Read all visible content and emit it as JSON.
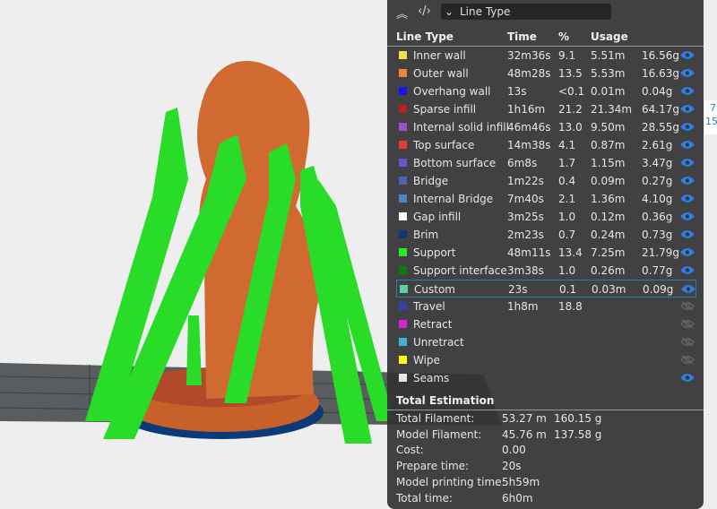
{
  "toolbar": {
    "collapse_icon": "double-chevron-up-icon",
    "code_icon": "code-brackets-icon",
    "view_select_value": "Line Type"
  },
  "table": {
    "headers": [
      "Line Type",
      "Time",
      "%",
      "Usage"
    ],
    "rows": [
      {
        "name": "Inner wall",
        "time": "32m36s",
        "pct": "9.1",
        "len": "5.51m",
        "weight": "16.56g",
        "color": "#f2e04a",
        "visible": true
      },
      {
        "name": "Outer wall",
        "time": "48m28s",
        "pct": "13.5",
        "len": "5.53m",
        "weight": "16.63g",
        "color": "#f08536",
        "visible": true
      },
      {
        "name": "Overhang wall",
        "time": "13s",
        "pct": "<0.1",
        "len": "0.01m",
        "weight": "0.04g",
        "color": "#1414f0",
        "visible": true
      },
      {
        "name": "Sparse infill",
        "time": "1h16m",
        "pct": "21.2",
        "len": "21.34m",
        "weight": "64.17g",
        "color": "#b22424",
        "visible": true
      },
      {
        "name": "Internal solid infill",
        "time": "46m46s",
        "pct": "13.0",
        "len": "9.50m",
        "weight": "28.55g",
        "color": "#9a52c8",
        "visible": true
      },
      {
        "name": "Top surface",
        "time": "14m38s",
        "pct": "4.1",
        "len": "0.87m",
        "weight": "2.61g",
        "color": "#e83a3a",
        "visible": true
      },
      {
        "name": "Bottom surface",
        "time": "6m8s",
        "pct": "1.7",
        "len": "1.15m",
        "weight": "3.47g",
        "color": "#6a55d0",
        "visible": true
      },
      {
        "name": "Bridge",
        "time": "1m22s",
        "pct": "0.4",
        "len": "0.09m",
        "weight": "0.27g",
        "color": "#4a62b0",
        "visible": true
      },
      {
        "name": "Internal Bridge",
        "time": "7m40s",
        "pct": "2.1",
        "len": "1.36m",
        "weight": "4.10g",
        "color": "#4a86c8",
        "visible": true
      },
      {
        "name": "Gap infill",
        "time": "3m25s",
        "pct": "1.0",
        "len": "0.12m",
        "weight": "0.36g",
        "color": "#ffffff",
        "visible": true
      },
      {
        "name": "Brim",
        "time": "2m23s",
        "pct": "0.7",
        "len": "0.24m",
        "weight": "0.73g",
        "color": "#0a3a78",
        "visible": true
      },
      {
        "name": "Support",
        "time": "48m11s",
        "pct": "13.4",
        "len": "7.25m",
        "weight": "21.79g",
        "color": "#22f022",
        "visible": true
      },
      {
        "name": "Support interface",
        "time": "3m38s",
        "pct": "1.0",
        "len": "0.26m",
        "weight": "0.77g",
        "color": "#0e7a0e",
        "visible": true
      },
      {
        "name": "Custom",
        "time": "23s",
        "pct": "0.1",
        "len": "0.03m",
        "weight": "0.09g",
        "color": "#5ed0a0",
        "visible": true,
        "selected": true
      },
      {
        "name": "Travel",
        "time": "1h8m",
        "pct": "18.8",
        "len": "",
        "weight": "",
        "color": "#3344a8",
        "visible": false
      },
      {
        "name": "Retract",
        "time": "",
        "pct": "",
        "len": "",
        "weight": "",
        "color": "#d028d0",
        "visible": false
      },
      {
        "name": "Unretract",
        "time": "",
        "pct": "",
        "len": "",
        "weight": "",
        "color": "#44b0d4",
        "visible": false
      },
      {
        "name": "Wipe",
        "time": "",
        "pct": "",
        "len": "",
        "weight": "",
        "color": "#ffff10",
        "visible": false
      },
      {
        "name": "Seams",
        "time": "",
        "pct": "",
        "len": "",
        "weight": "",
        "color": "#e6e6e6",
        "visible": true
      }
    ]
  },
  "total": {
    "title": "Total Estimation",
    "lines": [
      {
        "label": "Total Filament:",
        "v1": "53.27 m",
        "v2": "160.15 g"
      },
      {
        "label": "Model Filament:",
        "v1": "45.76 m",
        "v2": "137.58 g"
      },
      {
        "label": "Cost:",
        "v1": "0.00",
        "v2": ""
      },
      {
        "label": "Prepare time:",
        "v1": "20s",
        "v2": ""
      },
      {
        "label": "Model printing time:",
        "v1": "5h59m",
        "v2": ""
      },
      {
        "label": "Total time:",
        "v1": "6h0m",
        "v2": ""
      }
    ]
  },
  "layer_slider": {
    "top_value": "7",
    "bottom_value": "15"
  },
  "colors": {
    "accent": "#2a7fd8",
    "panel_bg": "#343436",
    "eye_visible": "#2f7fe6",
    "eye_hidden": "#6a6a6a"
  }
}
